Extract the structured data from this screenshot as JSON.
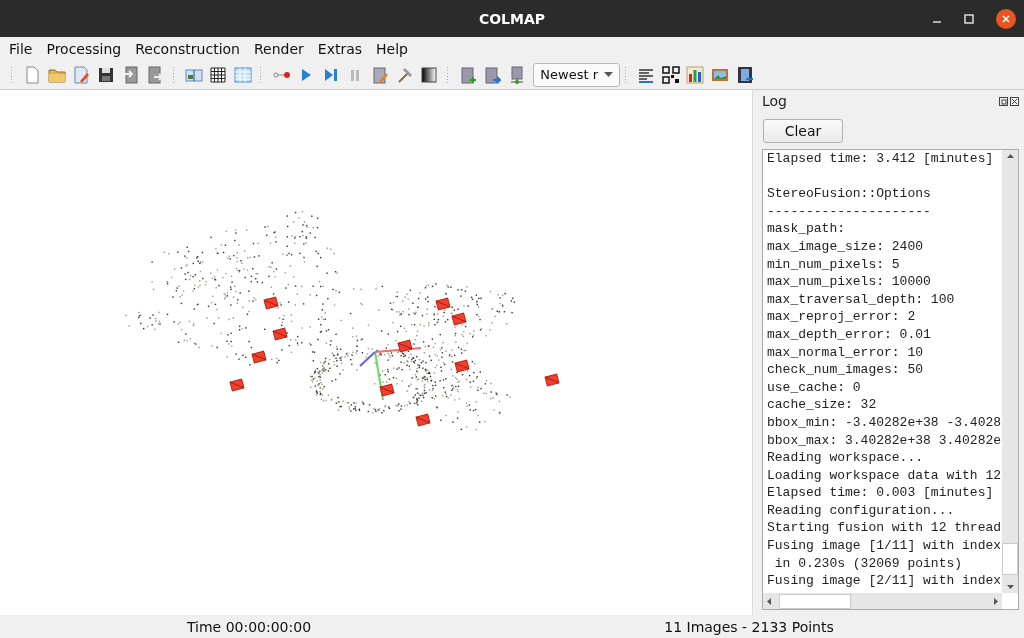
{
  "window": {
    "title": "COLMAP"
  },
  "menu": [
    "File",
    "Processing",
    "Reconstruction",
    "Render",
    "Extras",
    "Help"
  ],
  "toolbar": {
    "dropdown": {
      "value": "Newest r"
    }
  },
  "log": {
    "title": "Log",
    "clear_button": "Clear",
    "lines": [
      {
        "text": "Elapsed time: 3.412 [minutes]"
      },
      {
        "text": "StereoFusion::Options",
        "blank_before": true
      },
      {
        "text": "---------------------"
      },
      {
        "text": "mask_path:"
      },
      {
        "text": "max_image_size: 2400"
      },
      {
        "text": "min_num_pixels: 5"
      },
      {
        "text": "max_num_pixels: 10000"
      },
      {
        "text": "max_traversal_depth: 100"
      },
      {
        "text": "max_reproj_error: 2"
      },
      {
        "text": "max_depth_error: 0.01"
      },
      {
        "text": "max_normal_error: 10"
      },
      {
        "text": "check_num_images: 50"
      },
      {
        "text": "use_cache: 0"
      },
      {
        "text": "cache_size: 32"
      },
      {
        "text": "bbox_min: -3.40282e+38 -3.4028"
      },
      {
        "text": "bbox_max: 3.40282e+38 3.40282e"
      },
      {
        "text": "Reading workspace..."
      },
      {
        "text": "Loading workspace data with 12"
      },
      {
        "text": "Elapsed time: 0.003 [minutes]"
      },
      {
        "text": "Reading configuration..."
      },
      {
        "text": "Starting fusion with 12 thread"
      },
      {
        "text": "Fusing image [1/11] with index"
      },
      {
        "text": " in 0.230s (32069 points)"
      },
      {
        "text": "Fusing image [2/11] with index"
      }
    ]
  },
  "status_bar": {
    "time": "Time 00:00:00:00",
    "summary": "11 Images - 2133 Points"
  }
}
